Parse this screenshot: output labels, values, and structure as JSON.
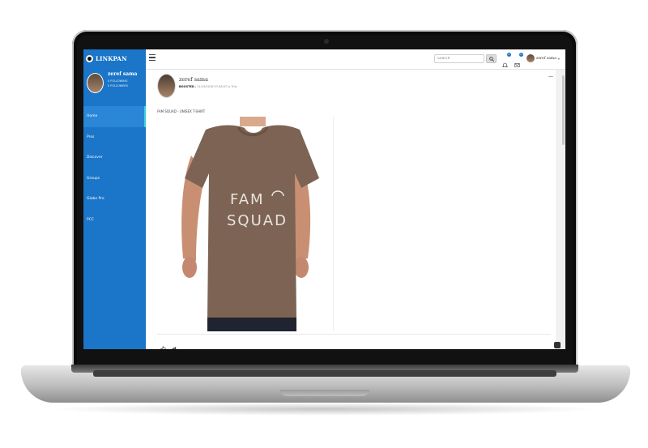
{
  "app": {
    "brand": "LINKPAN"
  },
  "sidebar": {
    "user_name": "zeref sama",
    "followers_label": "0 FOLLOWING",
    "following_label": "0 FOLLOWERS",
    "items": [
      {
        "label": "Home"
      },
      {
        "label": "Pros"
      },
      {
        "label": "Discover"
      },
      {
        "label": "Groups"
      },
      {
        "label": "Globe Pro"
      },
      {
        "label": "PCC"
      }
    ]
  },
  "topbar": {
    "search_placeholder": "Search",
    "notifications_count": "0",
    "messages_count": "0",
    "user_name": "zeref sama"
  },
  "post": {
    "author": "zeref sama",
    "boosted_label": "BOOSTED",
    "meta": "| 11/19/2018 07:08:07 is This",
    "caption": "FAM SQUAD - UNISEX T-SHIRT",
    "shirt_text_line1": "FAM",
    "shirt_text_line2": "SQUAD",
    "menu_glyph": "—"
  },
  "colors": {
    "sidebar": "#1b75c8",
    "accent": "#39d0d8",
    "shirt": "#7c6353"
  }
}
